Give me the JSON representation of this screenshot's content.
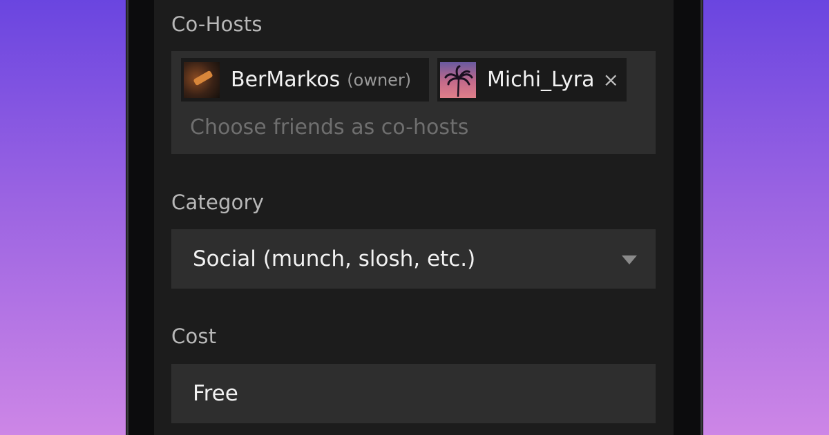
{
  "cohosts": {
    "label": "Co-Hosts",
    "placeholder": "Choose friends as co-hosts",
    "chips": [
      {
        "name": "BerMarkos",
        "role": "(owner)",
        "avatar": "person-photo-icon"
      },
      {
        "name": "Michi_Lyra",
        "remove_glyph": "×",
        "avatar": "palm-tree-sunset-icon"
      }
    ]
  },
  "category": {
    "label": "Category",
    "value": "Social (munch, slosh, etc.)"
  },
  "cost": {
    "label": "Cost",
    "value": "Free"
  },
  "colors": {
    "background_top": "#6a45e0",
    "background_bottom": "#cd86e6",
    "screen": "#1c1c1c",
    "field": "#2e2e2e",
    "chip": "#1a1a1a"
  }
}
